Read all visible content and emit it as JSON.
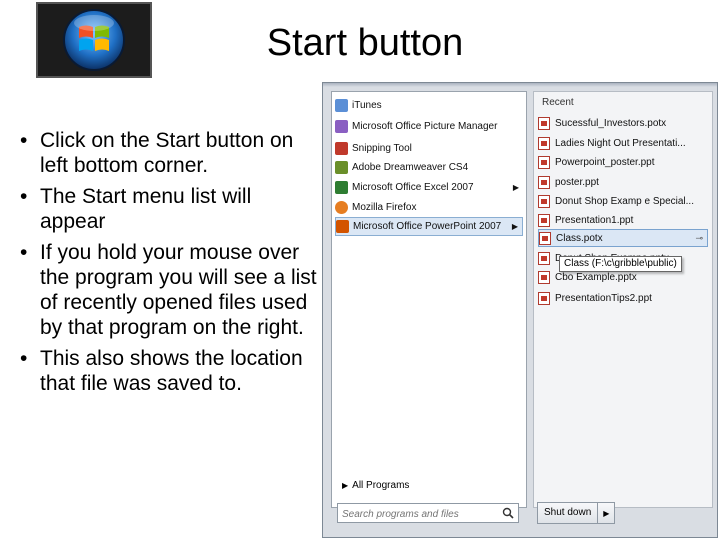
{
  "slide": {
    "title": "Start button",
    "bullets": [
      "Click on the Start button on left bottom corner.",
      "The Start menu list will appear",
      "If you hold your mouse over the program you will see a list of recently opened files used by that program on the right.",
      "This also shows the location that file was saved to."
    ]
  },
  "start_menu": {
    "programs": [
      {
        "label": "iTunes",
        "icon": "itunes-icon",
        "color": "#5b8fd6",
        "has_arrow": false
      },
      {
        "label": "Microsoft Office Picture Manager",
        "icon": "picture-manager-icon",
        "color": "#8a5fc2",
        "has_arrow": false
      },
      {
        "label": "Snipping Tool",
        "icon": "scissors-icon",
        "color": "#c0392b",
        "has_arrow": false
      },
      {
        "label": "Adobe Dreamweaver CS4",
        "icon": "dreamweaver-icon",
        "color": "#6a8f2a",
        "has_arrow": false
      },
      {
        "label": "Microsoft Office Excel 2007",
        "icon": "excel-icon",
        "color": "#2e7d32",
        "has_arrow": true
      },
      {
        "label": "Mozilla Firefox",
        "icon": "firefox-icon",
        "color": "#e67e22",
        "has_arrow": false
      },
      {
        "label": "Microsoft Office PowerPoint 2007",
        "icon": "powerpoint-icon",
        "color": "#d35400",
        "has_arrow": true
      }
    ],
    "all_programs": "All Programs",
    "recent_header": "Recent",
    "recent": [
      "Sucessful_Investors.potx",
      "Ladies Night Out Presentati...",
      "Powerpoint_poster.ppt",
      "poster.ppt",
      "Donut Shop Examp e Special...",
      "Presentation1.ppt",
      "Class.potx",
      "Donut Shop Exampe.pptx",
      "Cbo Example.pptx",
      "PresentationTips2.ppt"
    ],
    "selected_recent": "Class.potx",
    "tooltip": "Class (F:\\c\\gribble\\public)",
    "search_placeholder": "Search programs and files",
    "shutdown_label": "Shut down"
  }
}
